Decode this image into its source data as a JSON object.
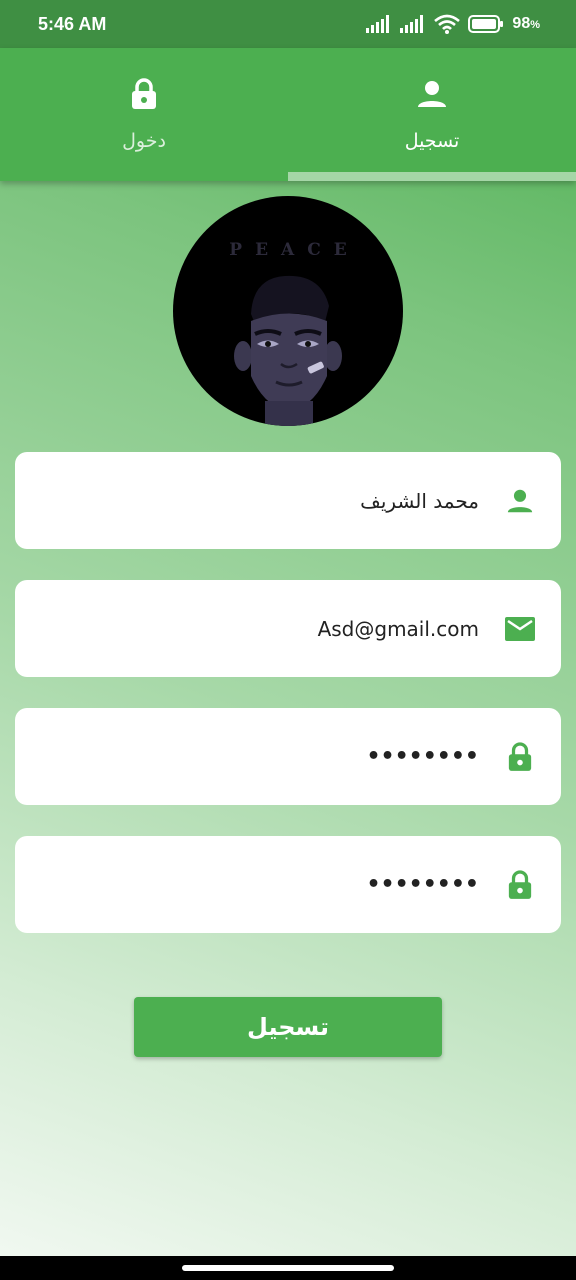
{
  "status_bar": {
    "time": "5:46 AM",
    "battery": "98"
  },
  "tabs": [
    {
      "label": "دخول",
      "icon": "lock-icon",
      "selected": false
    },
    {
      "label": "تسجيل",
      "icon": "person-icon",
      "selected": true
    }
  ],
  "avatar": {
    "caption": "PEACE"
  },
  "form": {
    "name_value": "محمد الشريف",
    "email_value": "Asd@gmail.com",
    "password_value": "••••••••",
    "confirm_password_value": "••••••••"
  },
  "submit_label": "تسجيل",
  "colors": {
    "primary": "#4caf50",
    "status_bar": "#3f8f43",
    "tab_indicator": "#a5d6a7"
  }
}
